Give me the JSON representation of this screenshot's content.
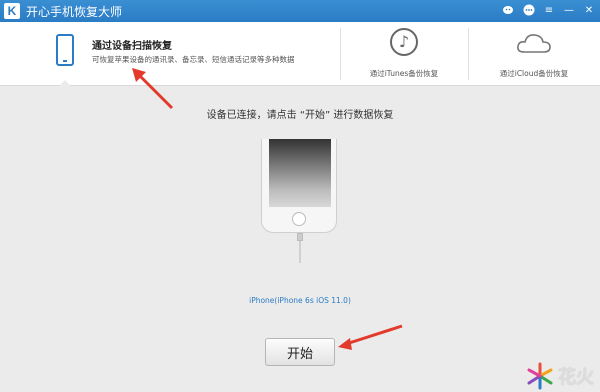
{
  "window": {
    "title": "开心手机恢复大师",
    "logo_letter": "K"
  },
  "controls": {
    "wechat": "微信",
    "feedback": "反馈",
    "menu": "≡",
    "minimize": "—",
    "close": "✕"
  },
  "modes": {
    "scan": {
      "title": "通过设备扫描恢复",
      "desc": "可恢复苹果设备的通讯录、备忘录、短信通话记录等多种数据"
    },
    "itunes": {
      "label": "通过iTunes备份恢复"
    },
    "icloud": {
      "label": "通过iCloud备份恢复"
    }
  },
  "main": {
    "instruction": "设备已连接，请点击 “开始” 进行数据恢复",
    "device": "iPhone(iPhone 6s iOS 11.0)",
    "start_label": "开始"
  },
  "watermark": {
    "text": "花火"
  },
  "colors": {
    "accent": "#2a7cc4",
    "arrow": "#e23a2d"
  }
}
